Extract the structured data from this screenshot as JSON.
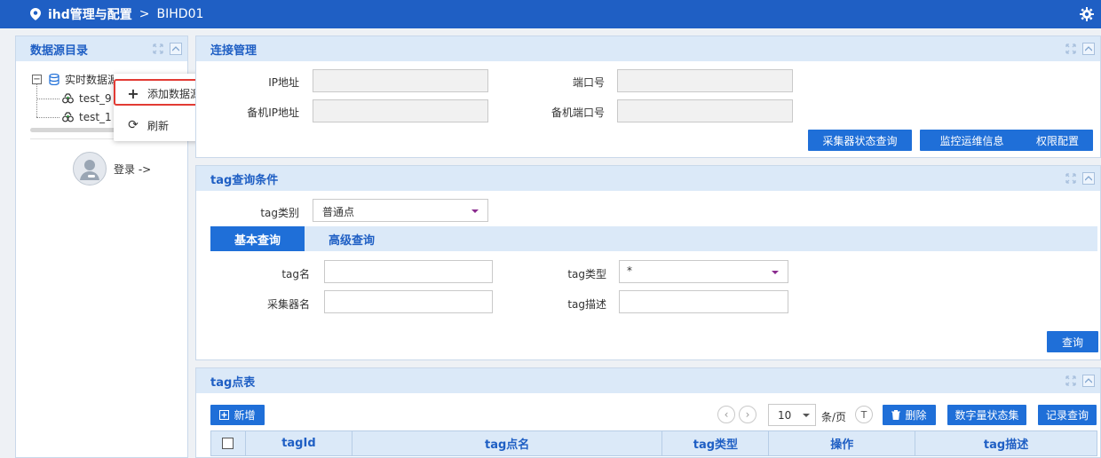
{
  "topbar": {
    "app_title": "ihd管理与配置",
    "separator": ">",
    "page": "BIHD01"
  },
  "left_panel": {
    "title": "数据源目录",
    "tree": {
      "root_label": "实时数据源",
      "expander": "−",
      "children": [
        "test_9",
        "test_1"
      ]
    },
    "login_label": "登录 ->"
  },
  "context_menu": {
    "items": [
      {
        "icon": "+",
        "label": "添加数据源"
      },
      {
        "icon": "⟳",
        "label": "刷新"
      }
    ]
  },
  "connection": {
    "title": "连接管理",
    "ip_label": "IP地址",
    "ip_value": "",
    "port_label": "端口号",
    "port_value": "",
    "backup_ip_label": "备机IP地址",
    "backup_ip_value": "",
    "backup_port_label": "备机端口号",
    "backup_port_value": "",
    "buttons": [
      "采集器状态查询",
      "监控运维信息",
      "权限配置"
    ]
  },
  "query": {
    "title": "tag查询条件",
    "tag_category_label": "tag类别",
    "tag_category_value": "普通点",
    "tabs": [
      "基本查询",
      "高级查询"
    ],
    "tag_name_label": "tag名",
    "tag_name_value": "",
    "tag_type_label": "tag类型",
    "tag_type_value": "*",
    "collector_label": "采集器名",
    "collector_value": "",
    "tag_desc_label": "tag描述",
    "tag_desc_value": "",
    "search_button": "查询"
  },
  "tag_table": {
    "title": "tag点表",
    "add_button": "新增",
    "page_size": "10",
    "per_page_label": "条/页",
    "delete_button": "删除",
    "digital_button": "数字量状态集",
    "record_button": "记录查询",
    "columns": [
      "tagId",
      "tag点名",
      "tag类型",
      "操作",
      "tag描述"
    ]
  },
  "colors": {
    "brand": "#1f5fc4",
    "button": "#1f6fd8",
    "header_bg": "#dbe9f8",
    "highlight": "#e23b34"
  }
}
